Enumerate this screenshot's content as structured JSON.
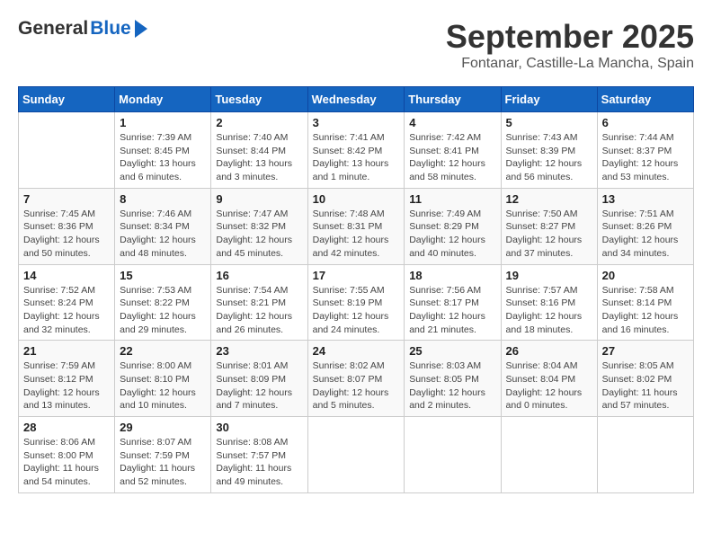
{
  "header": {
    "logo_general": "General",
    "logo_blue": "Blue",
    "month": "September 2025",
    "location": "Fontanar, Castille-La Mancha, Spain"
  },
  "days_of_week": [
    "Sunday",
    "Monday",
    "Tuesday",
    "Wednesday",
    "Thursday",
    "Friday",
    "Saturday"
  ],
  "weeks": [
    [
      {
        "day": "",
        "info": ""
      },
      {
        "day": "1",
        "info": "Sunrise: 7:39 AM\nSunset: 8:45 PM\nDaylight: 13 hours\nand 6 minutes."
      },
      {
        "day": "2",
        "info": "Sunrise: 7:40 AM\nSunset: 8:44 PM\nDaylight: 13 hours\nand 3 minutes."
      },
      {
        "day": "3",
        "info": "Sunrise: 7:41 AM\nSunset: 8:42 PM\nDaylight: 13 hours\nand 1 minute."
      },
      {
        "day": "4",
        "info": "Sunrise: 7:42 AM\nSunset: 8:41 PM\nDaylight: 12 hours\nand 58 minutes."
      },
      {
        "day": "5",
        "info": "Sunrise: 7:43 AM\nSunset: 8:39 PM\nDaylight: 12 hours\nand 56 minutes."
      },
      {
        "day": "6",
        "info": "Sunrise: 7:44 AM\nSunset: 8:37 PM\nDaylight: 12 hours\nand 53 minutes."
      }
    ],
    [
      {
        "day": "7",
        "info": "Sunrise: 7:45 AM\nSunset: 8:36 PM\nDaylight: 12 hours\nand 50 minutes."
      },
      {
        "day": "8",
        "info": "Sunrise: 7:46 AM\nSunset: 8:34 PM\nDaylight: 12 hours\nand 48 minutes."
      },
      {
        "day": "9",
        "info": "Sunrise: 7:47 AM\nSunset: 8:32 PM\nDaylight: 12 hours\nand 45 minutes."
      },
      {
        "day": "10",
        "info": "Sunrise: 7:48 AM\nSunset: 8:31 PM\nDaylight: 12 hours\nand 42 minutes."
      },
      {
        "day": "11",
        "info": "Sunrise: 7:49 AM\nSunset: 8:29 PM\nDaylight: 12 hours\nand 40 minutes."
      },
      {
        "day": "12",
        "info": "Sunrise: 7:50 AM\nSunset: 8:27 PM\nDaylight: 12 hours\nand 37 minutes."
      },
      {
        "day": "13",
        "info": "Sunrise: 7:51 AM\nSunset: 8:26 PM\nDaylight: 12 hours\nand 34 minutes."
      }
    ],
    [
      {
        "day": "14",
        "info": "Sunrise: 7:52 AM\nSunset: 8:24 PM\nDaylight: 12 hours\nand 32 minutes."
      },
      {
        "day": "15",
        "info": "Sunrise: 7:53 AM\nSunset: 8:22 PM\nDaylight: 12 hours\nand 29 minutes."
      },
      {
        "day": "16",
        "info": "Sunrise: 7:54 AM\nSunset: 8:21 PM\nDaylight: 12 hours\nand 26 minutes."
      },
      {
        "day": "17",
        "info": "Sunrise: 7:55 AM\nSunset: 8:19 PM\nDaylight: 12 hours\nand 24 minutes."
      },
      {
        "day": "18",
        "info": "Sunrise: 7:56 AM\nSunset: 8:17 PM\nDaylight: 12 hours\nand 21 minutes."
      },
      {
        "day": "19",
        "info": "Sunrise: 7:57 AM\nSunset: 8:16 PM\nDaylight: 12 hours\nand 18 minutes."
      },
      {
        "day": "20",
        "info": "Sunrise: 7:58 AM\nSunset: 8:14 PM\nDaylight: 12 hours\nand 16 minutes."
      }
    ],
    [
      {
        "day": "21",
        "info": "Sunrise: 7:59 AM\nSunset: 8:12 PM\nDaylight: 12 hours\nand 13 minutes."
      },
      {
        "day": "22",
        "info": "Sunrise: 8:00 AM\nSunset: 8:10 PM\nDaylight: 12 hours\nand 10 minutes."
      },
      {
        "day": "23",
        "info": "Sunrise: 8:01 AM\nSunset: 8:09 PM\nDaylight: 12 hours\nand 7 minutes."
      },
      {
        "day": "24",
        "info": "Sunrise: 8:02 AM\nSunset: 8:07 PM\nDaylight: 12 hours\nand 5 minutes."
      },
      {
        "day": "25",
        "info": "Sunrise: 8:03 AM\nSunset: 8:05 PM\nDaylight: 12 hours\nand 2 minutes."
      },
      {
        "day": "26",
        "info": "Sunrise: 8:04 AM\nSunset: 8:04 PM\nDaylight: 12 hours\nand 0 minutes."
      },
      {
        "day": "27",
        "info": "Sunrise: 8:05 AM\nSunset: 8:02 PM\nDaylight: 11 hours\nand 57 minutes."
      }
    ],
    [
      {
        "day": "28",
        "info": "Sunrise: 8:06 AM\nSunset: 8:00 PM\nDaylight: 11 hours\nand 54 minutes."
      },
      {
        "day": "29",
        "info": "Sunrise: 8:07 AM\nSunset: 7:59 PM\nDaylight: 11 hours\nand 52 minutes."
      },
      {
        "day": "30",
        "info": "Sunrise: 8:08 AM\nSunset: 7:57 PM\nDaylight: 11 hours\nand 49 minutes."
      },
      {
        "day": "",
        "info": ""
      },
      {
        "day": "",
        "info": ""
      },
      {
        "day": "",
        "info": ""
      },
      {
        "day": "",
        "info": ""
      }
    ]
  ]
}
